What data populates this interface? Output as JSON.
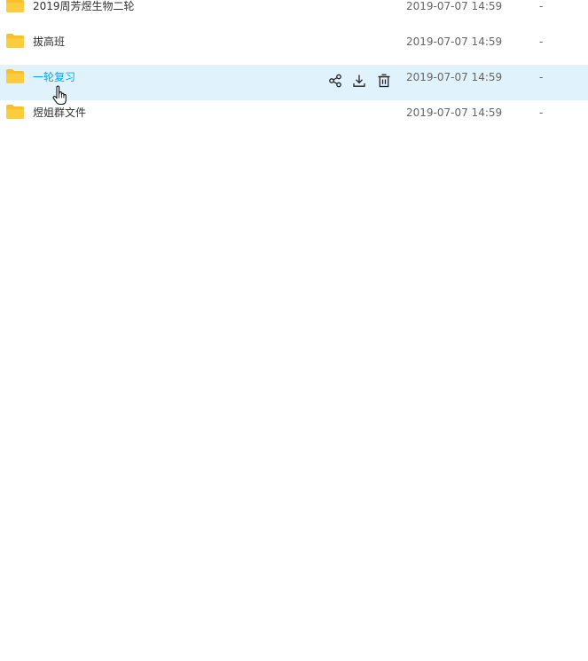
{
  "colors": {
    "folder": "#f7c02b",
    "hover_row_bg": "#e0f2fc",
    "hover_text": "#06a7ff",
    "text": "#333333",
    "meta_text": "#666666"
  },
  "files": [
    {
      "name": "2019周芳煜生物二轮",
      "modified": "2019-07-07 14:59",
      "size": "-",
      "icon": "folder-icon"
    },
    {
      "name": "拔高班",
      "modified": "2019-07-07 14:59",
      "size": "-",
      "icon": "folder-icon"
    },
    {
      "name": "一轮复习",
      "modified": "2019-07-07 14:59",
      "size": "-",
      "icon": "folder-icon",
      "hovered": true,
      "actions": [
        "share-icon",
        "download-icon",
        "delete-icon"
      ]
    },
    {
      "name": "煜姐群文件",
      "modified": "2019-07-07 14:59",
      "size": "-",
      "icon": "folder-icon"
    }
  ],
  "cursor": "hand-pointer-cursor"
}
